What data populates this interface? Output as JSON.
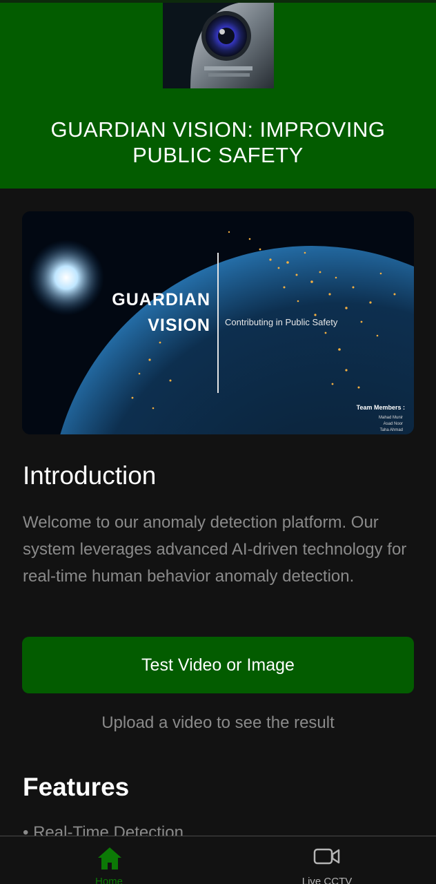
{
  "header": {
    "logo_icon": "robot-eye-logo",
    "title": "GUARDIAN VISION: IMPROVING PUBLIC SAFETY"
  },
  "banner": {
    "brand_line1": "GUARDIAN",
    "brand_line2": "VISION",
    "tagline": "Contributing in Public Safety",
    "team_title": "Team Members :",
    "team_members": [
      "Mahad Munir",
      "Asad Noor",
      "Taha Ahmad"
    ]
  },
  "intro": {
    "heading": "Introduction",
    "text": "Welcome to our anomaly detection platform. Our system leverages advanced AI-driven technology for real-time human behavior anomaly detection."
  },
  "cta": {
    "label": "Test Video or Image",
    "hint": "Upload a video to see the result"
  },
  "features": {
    "heading": "Features",
    "items": [
      "Real-Time Detection"
    ]
  },
  "nav": {
    "home_label": "Home",
    "home_icon": "home-icon",
    "cctv_label": "Live CCTV",
    "cctv_icon": "video-camera-icon"
  },
  "colors": {
    "brand_green": "#035c00",
    "background": "#121212",
    "active_nav": "#0c7a06",
    "muted_text": "#8a8a8a"
  }
}
